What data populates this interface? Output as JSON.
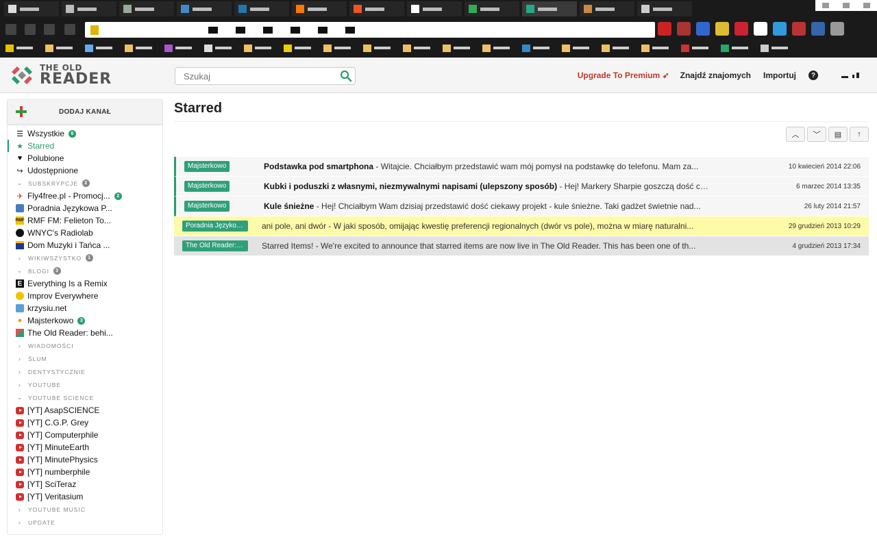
{
  "app": {
    "logo_line1": "THE OLD",
    "logo_line2": "READER"
  },
  "search": {
    "placeholder": "Szukaj"
  },
  "header": {
    "premium": "Upgrade To Premium",
    "find_friends": "Znajdź znajomych",
    "import": "Importuj",
    "help": "?"
  },
  "sidebar": {
    "add_feed": "DODAJ KANAŁ",
    "top_items": [
      {
        "label": "Wszystkie",
        "count": "6",
        "icon": "list-icon"
      },
      {
        "label": "Starred",
        "icon": "star-icon"
      },
      {
        "label": "Polubione",
        "icon": "heart-icon"
      },
      {
        "label": "Udostępnione",
        "icon": "share-icon"
      }
    ],
    "subskrypcje": {
      "label": "SUBSKRYPCJE",
      "count": "2"
    },
    "subscriptions": [
      {
        "label": "Fly4free.pl - Promocj...",
        "count": "2"
      },
      {
        "label": "Poradnia Językowa P..."
      },
      {
        "label": "RMF FM: Felieton To..."
      },
      {
        "label": "WNYC's Radiolab"
      },
      {
        "label": "Dom Muzyki i Tańca ..."
      }
    ],
    "wikiwszystko": {
      "label": "WIKIWSZYSTKO",
      "count": "1"
    },
    "blogi": {
      "label": "BLOGI",
      "count": "3"
    },
    "blogs": [
      {
        "label": "Everything Is a Remix"
      },
      {
        "label": "Improv Everywhere"
      },
      {
        "label": "krzysiu.net"
      },
      {
        "label": "Majsterkowo",
        "count": "3"
      },
      {
        "label": "The Old Reader: behi..."
      }
    ],
    "folders_mid": [
      "WIADOMOŚCI",
      "ŚLUM",
      "DENTYSTYCZNIE",
      "YOUTUBE"
    ],
    "youtube_science": {
      "label": "YOUTUBE SCIENCE"
    },
    "youtube": [
      "[YT] AsapSCIENCE",
      "[YT] C.G.P. Grey",
      "[YT] Computerphile",
      "[YT] MinuteEarth",
      "[YT] MinutePhysics",
      "[YT] numberphile",
      "[YT] SciTeraz",
      "[YT] Veritasium"
    ],
    "folders_end": [
      "YOUTUBE MUSIC",
      "UPDATE"
    ]
  },
  "main": {
    "title": "Starred",
    "items": [
      {
        "tag": "Majsterkowo",
        "title": "Podstawka pod smartphona",
        "snippet": " - Witajcie. Chciałbym przedstawić wam mój pomysł na podstawkę do telefonu. Mam za...",
        "date": "10 kwiecień 2014 22:06",
        "style": "starred"
      },
      {
        "tag": "Majsterkowo",
        "title": "Kubki i poduszki z własnymi, niezmywalnymi napisami (ulepszony sposób)",
        "snippet": " - Hej! Markery Sharpie goszczą dość czę...",
        "date": "6 marzec 2014 13:35",
        "style": "starred"
      },
      {
        "tag": "Majsterkowo",
        "title": "Kule śnieżne",
        "snippet": " - Hej! Chciałbym Wam dzisiaj przedstawić dość ciekawy projekt - kule śnieżne. Taki gadżet świetnie nad...",
        "date": "26 luty 2014 21:57",
        "style": "starred"
      },
      {
        "tag": "Poradnia Językow...",
        "title": "",
        "snippet": "ani pole, ani dwór - W jaki sposób, omijając kwestię preferencji regionalnych (dwór vs pole), można w miarę naturalni...",
        "date": "29 grudzień 2013 10:29",
        "style": "yellow"
      },
      {
        "tag": "The Old Reader: b...",
        "title": "",
        "snippet": "Starred Items! - We're excited to announce that starred items are now live in The Old Reader.  This has been one of th...",
        "date": "4 grudzień 2013 17:34",
        "style": "gray"
      }
    ]
  },
  "colors": {
    "accent": "#2a9d6e",
    "premium": "#c0392b",
    "highlight": "#fdfaa8"
  }
}
